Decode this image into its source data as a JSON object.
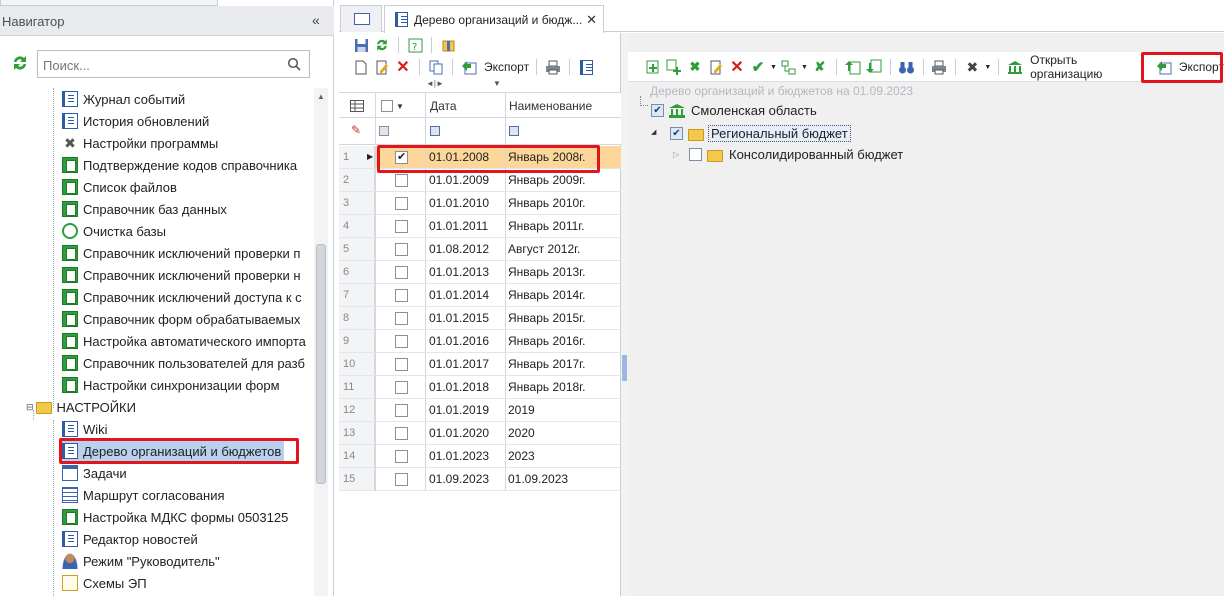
{
  "navigator": {
    "title": "Навигатор",
    "collapse": "«",
    "search_placeholder": "Поиск...",
    "items": [
      {
        "label": "Журнал событий",
        "icon": "book-icon"
      },
      {
        "label": "История обновлений",
        "icon": "book-icon"
      },
      {
        "label": "Настройки программы",
        "icon": "tools-icon"
      },
      {
        "label": "Подтверждение кодов справочника",
        "icon": "green-book-icon"
      },
      {
        "label": "Список файлов",
        "icon": "green-book-icon"
      },
      {
        "label": "Справочник баз данных",
        "icon": "green-book-icon"
      },
      {
        "label": "Очистка базы",
        "icon": "history-icon"
      },
      {
        "label": "Справочник исключений проверки п",
        "icon": "green-book-icon"
      },
      {
        "label": "Справочник исключений проверки н",
        "icon": "green-book-icon"
      },
      {
        "label": "Справочник исключений доступа к с",
        "icon": "green-book-icon"
      },
      {
        "label": "Справочник форм обрабатываемых",
        "icon": "green-book-icon"
      },
      {
        "label": "Настройка автоматического импорта",
        "icon": "green-book-icon"
      },
      {
        "label": "Справочник пользователей для разб",
        "icon": "green-book-icon"
      },
      {
        "label": "Настройки синхронизации форм",
        "icon": "green-book-icon"
      }
    ],
    "folder": "НАСТРОЙКИ",
    "folder_items": [
      {
        "label": "Wiki",
        "icon": "book-icon"
      },
      {
        "label": "Дерево организаций и бюджетов",
        "icon": "book-icon"
      },
      {
        "label": "Задачи",
        "icon": "calendar-icon"
      },
      {
        "label": "Маршрут согласования",
        "icon": "route-icon"
      },
      {
        "label": "Настройка МДКС формы 0503125",
        "icon": "green-book-icon"
      },
      {
        "label": "Редактор новостей",
        "icon": "book-icon"
      },
      {
        "label": "Режим \"Руководитель\"",
        "icon": "user-icon"
      },
      {
        "label": "Схемы ЭП",
        "icon": "doc-icon"
      }
    ]
  },
  "tabs": {
    "active_title": "Дерево организаций и бюдж...",
    "close": "✕"
  },
  "left_toolbar": {
    "export_label": "Экспорт"
  },
  "grid": {
    "columns": {
      "date": "Дата",
      "name": "Наименование"
    },
    "rows": [
      {
        "num": "1",
        "date": "01.01.2008",
        "name": "Январь 2008г.",
        "checked": true
      },
      {
        "num": "2",
        "date": "01.01.2009",
        "name": "Январь 2009г.",
        "checked": false
      },
      {
        "num": "3",
        "date": "01.01.2010",
        "name": "Январь 2010г.",
        "checked": false
      },
      {
        "num": "4",
        "date": "01.01.2011",
        "name": "Январь 2011г.",
        "checked": false
      },
      {
        "num": "5",
        "date": "01.08.2012",
        "name": "Август 2012г.",
        "checked": false
      },
      {
        "num": "6",
        "date": "01.01.2013",
        "name": "Январь 2013г.",
        "checked": false
      },
      {
        "num": "7",
        "date": "01.01.2014",
        "name": "Январь 2014г.",
        "checked": false
      },
      {
        "num": "8",
        "date": "01.01.2015",
        "name": "Январь 2015г.",
        "checked": false
      },
      {
        "num": "9",
        "date": "01.01.2016",
        "name": "Январь 2016г.",
        "checked": false
      },
      {
        "num": "10",
        "date": "01.01.2017",
        "name": "Январь 2017г.",
        "checked": false
      },
      {
        "num": "11",
        "date": "01.01.2018",
        "name": "Январь 2018г.",
        "checked": false
      },
      {
        "num": "12",
        "date": "01.01.2019",
        "name": "2019",
        "checked": false
      },
      {
        "num": "13",
        "date": "01.01.2020",
        "name": "2020",
        "checked": false
      },
      {
        "num": "14",
        "date": "01.01.2023",
        "name": "2023",
        "checked": false
      },
      {
        "num": "15",
        "date": "01.09.2023",
        "name": "01.09.2023",
        "checked": false
      }
    ]
  },
  "right_toolbar": {
    "open_org_label": "Открыть организацию",
    "export_label": "Экспорт"
  },
  "org_tree": {
    "caption": "Дерево организаций и бюджетов на 01.09.2023",
    "nodes": [
      {
        "label": "Смоленская область"
      },
      {
        "label": "Региональный бюджет"
      },
      {
        "label": "Консолидированный бюджет"
      }
    ]
  },
  "colors": {
    "highlight_red": "#e0161c",
    "selected_row": "#fcd799",
    "selected_item": "#b9d1ef"
  }
}
